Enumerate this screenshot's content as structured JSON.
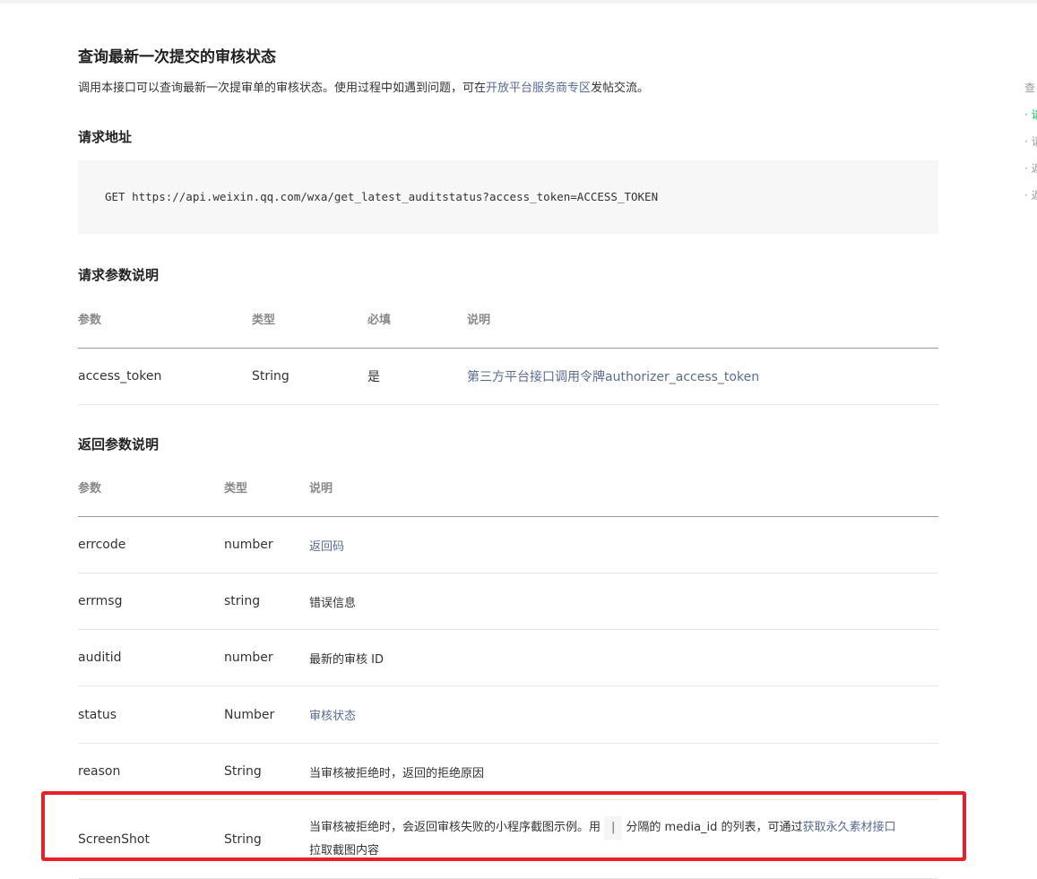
{
  "doc": {
    "title": "查询最新一次提交的审核状态",
    "intro_before": "调用本接口可以查询最新一次提审单的审核状态。使用过程中如遇到问题，可在",
    "intro_link": "开放平台服务商专区",
    "intro_after": "发帖交流。"
  },
  "request_url": {
    "heading": "请求地址",
    "code": "GET https://api.weixin.qq.com/wxa/get_latest_auditstatus?access_token=ACCESS_TOKEN"
  },
  "request_params": {
    "heading": "请求参数说明",
    "headers": [
      "参数",
      "类型",
      "必填",
      "说明"
    ],
    "rows": [
      {
        "param": "access_token",
        "type": "String",
        "required": "是",
        "desc": "第三方平台接口调用令牌authorizer_access_token"
      }
    ]
  },
  "response_params": {
    "heading": "返回参数说明",
    "headers": [
      "参数",
      "类型",
      "说明"
    ],
    "rows": [
      {
        "param": "errcode",
        "type": "number",
        "desc": "返回码"
      },
      {
        "param": "errmsg",
        "type": "string",
        "desc": "错误信息"
      },
      {
        "param": "auditid",
        "type": "number",
        "desc": "最新的审核 ID"
      },
      {
        "param": "status",
        "type": "Number",
        "desc": "审核状态"
      },
      {
        "param": "reason",
        "type": "String",
        "desc": "当审核被拒绝时，返回的拒绝原因"
      },
      {
        "param": "ScreenShot",
        "type": "String",
        "desc_part1": "当审核被拒绝时，会返回审核失败的小程序截图示例。用",
        "desc_pipe": "|",
        "desc_part2": "分隔的 media_id 的列表，可通过",
        "desc_link": "获取永久素材接口",
        "desc_line2": "拉取截图内容"
      }
    ]
  },
  "toc": {
    "items": [
      "查",
      "· 请",
      "· 请",
      "· 返",
      "· 返"
    ]
  },
  "colors": {
    "link": "#576b95",
    "highlight_border": "#e8202a",
    "toc_active": "#07c160"
  }
}
